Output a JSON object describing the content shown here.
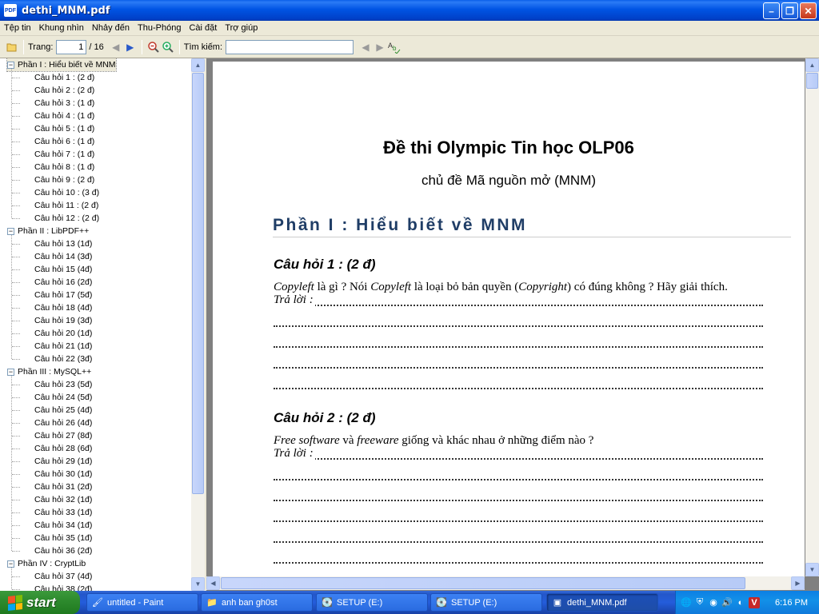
{
  "window": {
    "title": "dethi_MNM.pdf",
    "icon_label": "PDF",
    "buttons": [
      "minimize",
      "maximize",
      "close"
    ]
  },
  "menu": [
    "Tệp tin",
    "Khung nhìn",
    "Nhảy đến",
    "Thu-Phóng",
    "Cài đặt",
    "Trợ giúp"
  ],
  "toolbar": {
    "page_label": "Trang:",
    "page_value": "1",
    "page_total": "/ 16",
    "search_label": "Tìm kiếm:",
    "search_value": ""
  },
  "outline": {
    "parts": [
      {
        "label": "Phần I : Hiểu biết về MNM",
        "items": [
          "Câu hỏi 1 : (2 đ)",
          "Câu hỏi 2 : (2 đ)",
          "Câu hỏi 3 : (1 đ)",
          "Câu hỏi 4 : (1 đ)",
          "Câu hỏi 5 : (1 đ)",
          "Câu hỏi 6 : (1 đ)",
          "Câu hỏi 7 : (1 đ)",
          "Câu hỏi 8 : (1 đ)",
          "Câu hỏi 9 : (2 đ)",
          "Câu hỏi 10 : (3 đ)",
          "Câu hỏi 11 : (2 đ)",
          "Câu hỏi 12 : (2 đ)"
        ]
      },
      {
        "label": "Phần II : LibPDF++",
        "items": [
          "Câu hỏi 13 (1đ)",
          "Câu hỏi 14 (3đ)",
          "Câu hỏi 15 (4đ)",
          "Câu hỏi 16 (2đ)",
          "Câu hỏi 17 (5đ)",
          "Câu hỏi 18 (4đ)",
          "Câu hỏi 19 (3đ)",
          "Câu hỏi 20 (1đ)",
          "Câu hỏi 21 (1đ)",
          "Câu hỏi 22 (3đ)"
        ]
      },
      {
        "label": "Phần III : MySQL++",
        "items": [
          "Câu hỏi 23 (5đ)",
          "Câu hỏi 24 (5đ)",
          "Câu hỏi 25 (4đ)",
          "Câu hỏi 26 (4đ)",
          "Câu hỏi 27 (8đ)",
          "Câu hỏi 28 (6đ)",
          "Câu hỏi 29 (1đ)",
          "Câu hỏi 30 (1đ)",
          "Câu hỏi 31 (2đ)",
          "Câu hỏi 32 (1đ)",
          "Câu hỏi 33 (1đ)",
          "Câu hỏi 34 (1đ)",
          "Câu hỏi 35 (1đ)",
          "Câu hỏi 36 (2đ)"
        ]
      },
      {
        "label": "Phần IV : CryptLib",
        "items": [
          "Câu hỏi 37 (4đ)",
          "Câu hỏi 38 (2đ)"
        ]
      }
    ]
  },
  "document": {
    "title": "Đề thi Olympic Tin học OLP06",
    "subtitle": "chủ đề Mã nguồn mở (MNM)",
    "part_heading": "Phần I : Hiểu biết về MNM",
    "answer_prefix": "Trả lời :",
    "q1": {
      "heading": "Câu hỏi 1 : (2 đ)",
      "t1": "Copyleft",
      "t2": " là gì ? Nói ",
      "t3": "Copyleft",
      "t4": " là loại bỏ bản quyền (",
      "t5": "Copyright",
      "t6": ") có đúng không ? Hãy giải thích."
    },
    "q2": {
      "heading": "Câu hỏi 2 : (2 đ)",
      "t1": "Free software",
      "t2": " và ",
      "t3": "freeware",
      "t4": " giống và khác nhau ở những điểm nào ?"
    }
  },
  "taskbar": {
    "start_label": "start",
    "tasks": [
      {
        "label": "untitled - Paint",
        "icon": "paint-icon"
      },
      {
        "label": "anh ban gh0st",
        "icon": "folder-icon"
      },
      {
        "label": "SETUP (E:)",
        "icon": "drive-icon"
      },
      {
        "label": "SETUP (E:)",
        "icon": "drive-icon"
      },
      {
        "label": "dethi_MNM.pdf",
        "icon": "pdf-icon",
        "active": true
      }
    ],
    "clock": "6:16 PM"
  },
  "colors": {
    "titlebar": "#0054E3",
    "heading_blue": "#1F3D66",
    "taskbar": "#245DDB",
    "start_green": "#2E8B2E"
  }
}
